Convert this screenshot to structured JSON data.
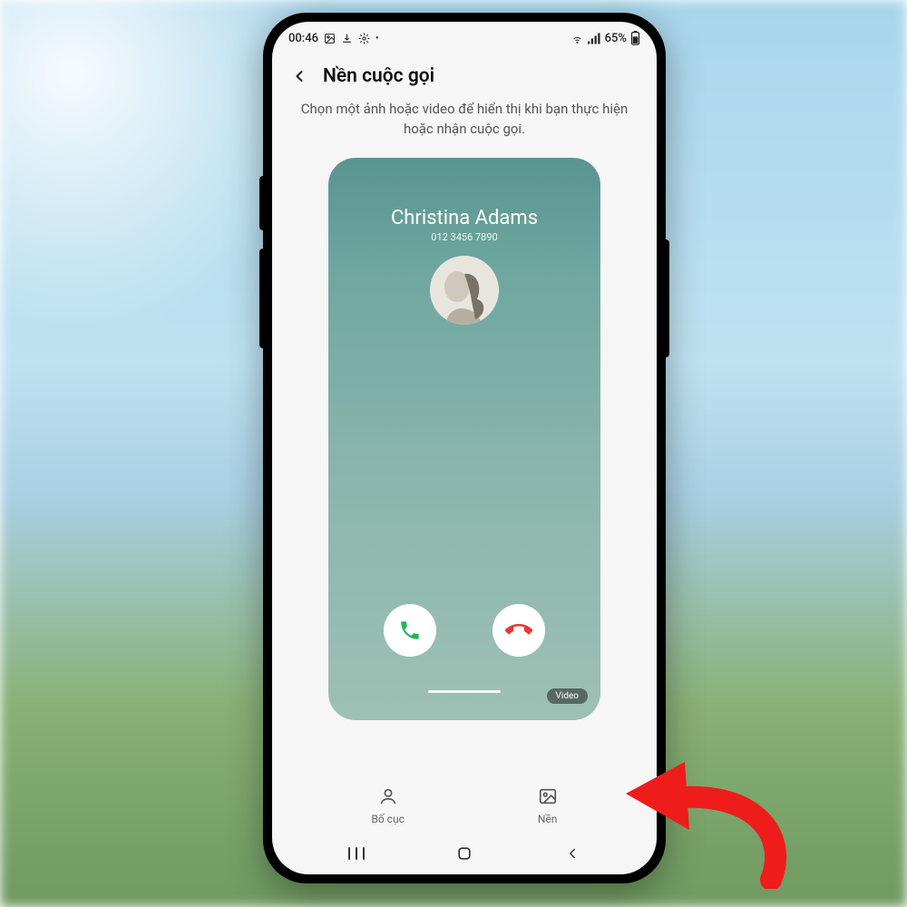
{
  "status": {
    "time": "00:46",
    "battery": "65%"
  },
  "header": {
    "title": "Nền cuộc gọi"
  },
  "description": "Chọn một ảnh hoặc video để hiển thị khi bạn thực hiện hoặc nhận cuộc gọi.",
  "preview": {
    "caller_name": "Christina Adams",
    "caller_number": "012 3456 7890",
    "chip_label": "Video"
  },
  "tabs": {
    "layout_label": "Bố cục",
    "background_label": "Nền"
  }
}
